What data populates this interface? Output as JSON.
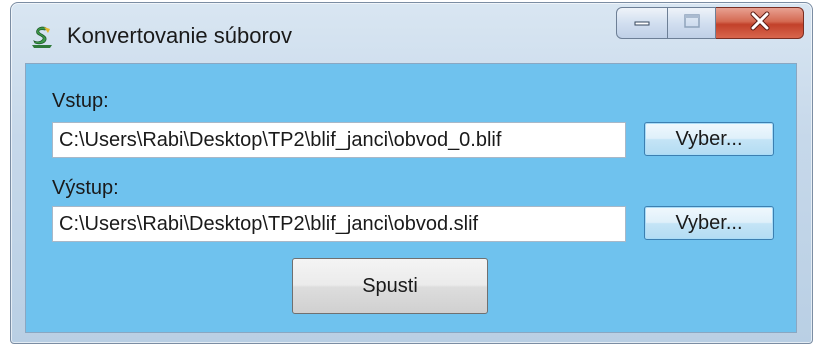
{
  "window": {
    "title": "Konvertovanie súborov",
    "icons": {
      "app": "app-icon",
      "minimize": "minimize-icon",
      "maximize": "maximize-icon",
      "close": "close-icon"
    },
    "colors": {
      "client_background": "#6fc2ee",
      "close_button": "#c2412a"
    }
  },
  "form": {
    "input": {
      "label": "Vstup:",
      "value": "C:\\Users\\Rabi\\Desktop\\TP2\\blif_janci\\obvod_0.blif",
      "browse_label": "Vyber..."
    },
    "output": {
      "label": "Výstup:",
      "value": "C:\\Users\\Rabi\\Desktop\\TP2\\blif_janci\\obvod.slif",
      "browse_label": "Vyber..."
    },
    "run_label": "Spusti"
  }
}
